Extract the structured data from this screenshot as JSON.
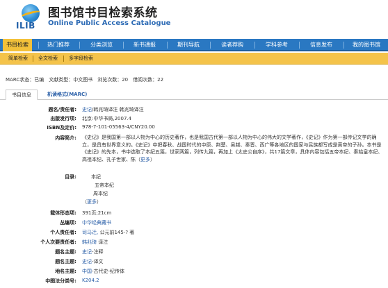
{
  "header": {
    "logo_text": "ILIB",
    "title": "图书馆书目检索系统",
    "subtitle": "Online Public Access Catalogue"
  },
  "nav": {
    "items": [
      {
        "label": "书目检索",
        "active": true
      },
      {
        "label": "热门推荐",
        "active": false
      },
      {
        "label": "分类浏览",
        "active": false
      },
      {
        "label": "新书通报",
        "active": false
      },
      {
        "label": "期刊导航",
        "active": false
      },
      {
        "label": "读者荐购",
        "active": false
      },
      {
        "label": "学科参考",
        "active": false
      },
      {
        "label": "信息发布",
        "active": false
      },
      {
        "label": "我的图书馆",
        "active": false
      }
    ]
  },
  "subnav": {
    "items": [
      {
        "label": "简单检索"
      },
      {
        "label": "全文检索"
      },
      {
        "label": "多字段检索"
      }
    ]
  },
  "status": {
    "text": "MARC状态：已编　文献类型：中文图书　浏览次数：20　借阅次数：22"
  },
  "tabs": {
    "book_info": "书目信息",
    "marc": "机读格式(MARC)"
  },
  "record": {
    "title_label": "题名/责任者:",
    "title_link": "史记",
    "title_rest": "/韩兆琦译注 韩兆琦译注",
    "publisher_label": "出版发行项:",
    "publisher": "北京:中华书局,2007.4",
    "isbn_label": "ISBN及定价:",
    "isbn": "978-7-101-05563-4/CNY20.00",
    "abstract_label": "内容简介:",
    "abstract": "《史记》是我国第一部以人物为中心的历史著作，也是我国古代第一部以人物为中心的伟大的文学著作，《史记》作为第一部传记文学的确立，是具有世界意义的。《史记》中把春秋、战国时代的中原、荆楚、吴越、秦晋、西广等各地区的国家与民族都写成是黄帝的子孙。本书是《史记》的先本，书中选取了本纪五篇，世家两篇，列传九篇，再加上《太史公自序》，共17篇文章，具体内容包括五帝本纪、秦始皇本纪、高祖本纪、孔子世家、陈（",
    "abstract_more": "更多",
    "abstract_end": "）",
    "contents_label": "目录:",
    "contents": [
      "本纪",
      "五帝本纪",
      "周本纪"
    ],
    "contents_more_open": "（",
    "contents_more": "更多",
    "contents_more_close": "）",
    "physical_label": "载体形态项:",
    "physical": "391页;21cm",
    "series_label": "丛编项:",
    "series": "中华经典藏书",
    "author_label": "个人责任者:",
    "author_link": "司马迁,",
    "author_rest": " 公元前145-? 著",
    "secondary_label": "个人次要责任者:",
    "secondary_link": "韩兆琦",
    "secondary_rest": " 译注",
    "subject1_label": "题名主题:",
    "subject1_link": "史记",
    "subject1_rest": "-注释",
    "subject2_label": "题名主题:",
    "subject2_link": "史记",
    "subject2_rest": "-译文",
    "geo_label": "地名主题:",
    "geo_link": "中国",
    "geo_rest": "-古代史-纪传体",
    "clc_label": "中图法分类号:",
    "clc": "K204.2"
  },
  "colors": {
    "nav_blue": "#2a78c2",
    "nav_active": "#f3c13a",
    "subnav_gold": "#f4c34a",
    "link": "#2a5fa8"
  }
}
